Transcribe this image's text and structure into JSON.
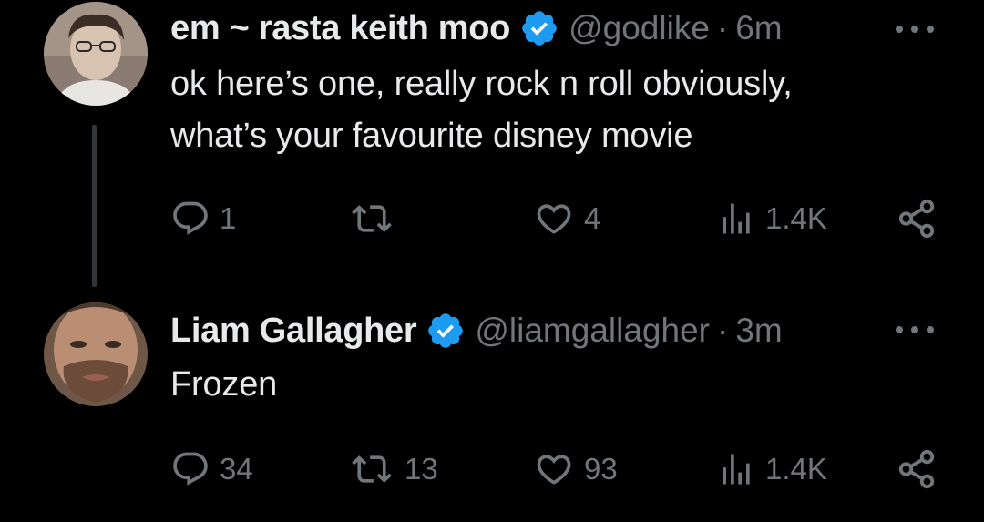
{
  "tweets": [
    {
      "display_name": "em ~ rasta keith moo",
      "handle": "@godlike",
      "separator": "·",
      "time": "6m",
      "text_lines": [
        "ok here’s one, really rock n roll obviously,",
        "what’s your favourite disney movie"
      ],
      "verified": true,
      "replies": "1",
      "retweets": "",
      "likes": "4",
      "views": "1.4K"
    },
    {
      "display_name": "Liam Gallagher",
      "handle": "@liamgallagher",
      "separator": "·",
      "time": "3m",
      "text_lines": [
        "Frozen"
      ],
      "verified": true,
      "replies": "34",
      "retweets": "13",
      "likes": "93",
      "views": "1.4K"
    }
  ],
  "colors": {
    "background": "#000000",
    "primary_text": "#e7e9ea",
    "secondary_text": "#71767b",
    "verified_badge": "#1d9bf0",
    "thread_line": "#333639"
  },
  "icons": {
    "reply": "reply-icon",
    "retweet": "retweet-icon",
    "like": "like-icon",
    "views": "views-icon",
    "share": "share-icon",
    "more": "more-icon",
    "verified": "verified-badge-icon"
  }
}
